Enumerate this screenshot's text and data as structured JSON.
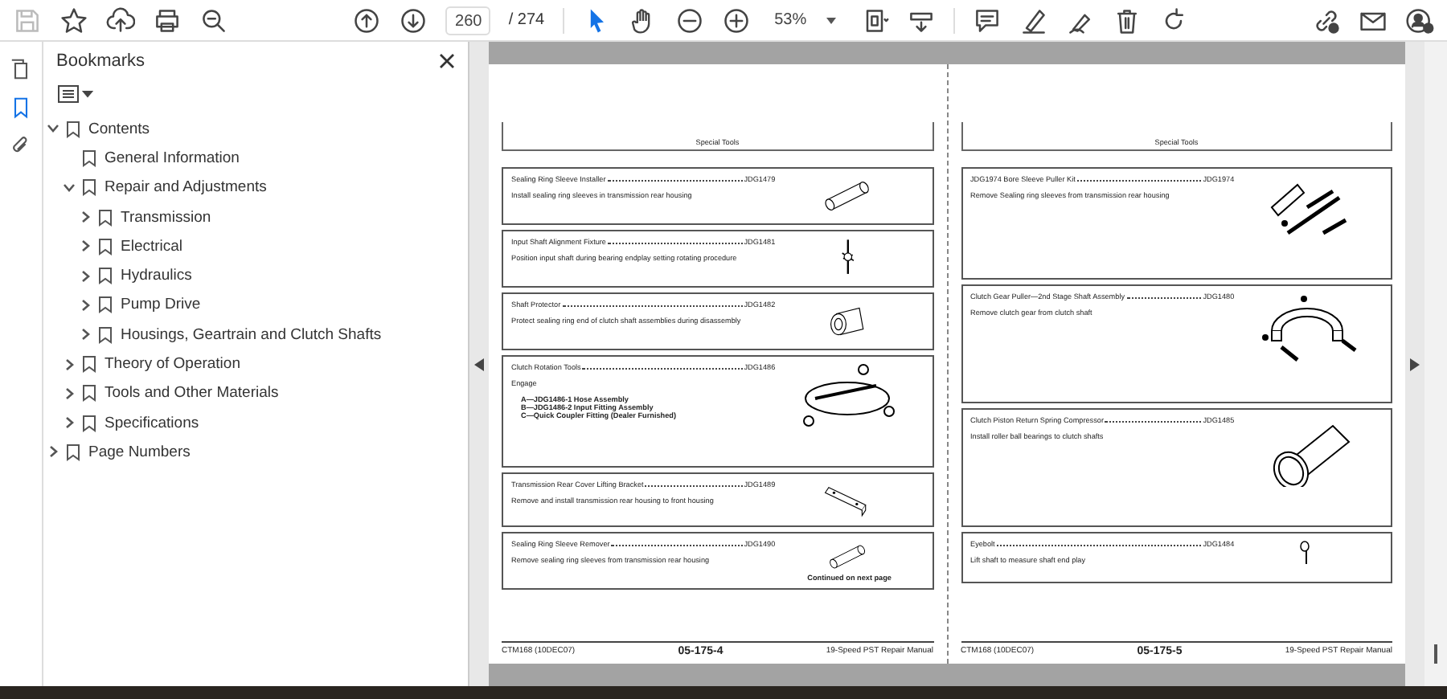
{
  "toolbar": {
    "save_disabled": true,
    "page_current": "260",
    "page_total": "/ 274",
    "tools": [
      {
        "selected": true
      },
      {
        "selected": false
      }
    ],
    "zoom": "53%"
  },
  "rail": [
    {
      "selected": false
    },
    {
      "selected": true
    },
    {
      "selected": false
    }
  ],
  "bookmarks": {
    "title": "Bookmarks",
    "items": [
      {
        "label": "Contents",
        "expanded": true,
        "children": [
          {
            "label": "General Information"
          },
          {
            "label": "Repair and Adjustments",
            "expanded": true,
            "children": [
              {
                "label": "Transmission",
                "expanded": false
              },
              {
                "label": "Electrical",
                "expanded": false
              },
              {
                "label": "Hydraulics",
                "expanded": false
              },
              {
                "label": "Pump Drive",
                "expanded": false
              },
              {
                "label": "Housings, Geartrain and Clutch Shafts",
                "expanded": false
              }
            ]
          },
          {
            "label": "Theory of Operation",
            "expanded": false
          },
          {
            "label": "Tools and Other Materials",
            "expanded": false
          },
          {
            "label": "Specifications",
            "expanded": false
          }
        ]
      },
      {
        "label": "Page Numbers",
        "expanded": false
      }
    ]
  },
  "pages": [
    {
      "header": "Special Tools",
      "tools": [
        {
          "kind": "sleeve",
          "name": "Sealing Ring Sleeve Installer",
          "part": "JDG1479",
          "description": "Install sealing ring sleeves in transmission rear housing"
        },
        {
          "kind": "fixture",
          "name": "Input Shaft Alignment Fixture",
          "part": "JDG1481",
          "description": "Position input shaft during bearing endplay setting rotating procedure"
        },
        {
          "kind": "tube",
          "name": "Shaft Protector",
          "part": "JDG1482",
          "description": "Protect sealing ring end of clutch shaft assemblies during disassembly"
        },
        {
          "kind": "hose",
          "name": "Clutch Rotation Tools",
          "part": "JDG1486",
          "description": "Engage",
          "legend": [
            "A—JDG1486-1 Hose Assembly",
            "B—JDG1486-2 Input Fitting Assembly",
            "C—Quick Coupler Fitting (Dealer Furnished)"
          ]
        },
        {
          "kind": "bracket",
          "name": "Transmission Rear Cover Lifting Bracket",
          "part": "JDG1489",
          "description": "Remove and install transmission rear housing to front housing"
        },
        {
          "kind": "sleeve",
          "name": "Sealing Ring Sleeve Remover",
          "part": "JDG1490",
          "description": "Remove sealing ring sleeves from transmission rear housing",
          "note": "Continued on next page"
        }
      ],
      "footer": {
        "code": "CTM168 (10DEC07)",
        "page": "05-175-4",
        "manual": "19-Speed PST Repair Manual"
      }
    },
    {
      "header": "Special Tools",
      "tools": [
        {
          "kind": "kit",
          "name": "JDG1974 Bore Sleeve Puller Kit",
          "part": "JDG1974",
          "description": "Remove Sealing ring sleeves from transmission rear housing"
        },
        {
          "kind": "puller",
          "name": "Clutch Gear Puller—2nd Stage Shaft Assembly",
          "part": "JDG1480",
          "description": "Remove clutch gear from clutch shaft"
        },
        {
          "kind": "compressor",
          "name": "Clutch Piston Return Spring Compressor",
          "part": "JDG1485",
          "description": "Install roller ball bearings to clutch shafts"
        },
        {
          "kind": "eyebolt",
          "name": "Eyebolt",
          "part": "JDG1484",
          "description": "Lift shaft to measure shaft end play"
        }
      ],
      "footer": {
        "code": "CTM168 (10DEC07)",
        "page": "05-175-5",
        "manual": "19-Speed PST Repair Manual"
      }
    }
  ]
}
